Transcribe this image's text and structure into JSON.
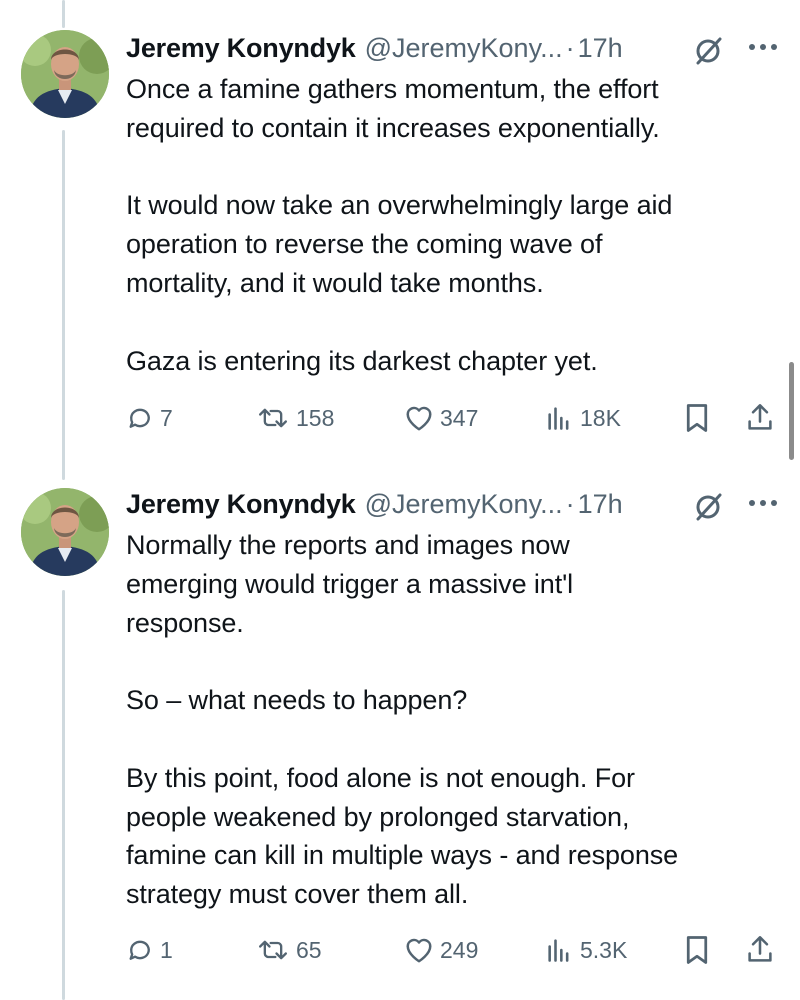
{
  "tweets": [
    {
      "author_name": "Jeremy Konyndyk",
      "handle": "@JeremyKony...",
      "separator": "·",
      "time": "17h",
      "text": "Once a famine gathers momentum, the effort\nrequired to contain it increases exponentially.\n\nIt would now take an overwhelmingly large aid\noperation to reverse the coming wave of\nmortality, and it would take months.\n\nGaza is entering its darkest chapter yet.",
      "replies": "7",
      "reposts": "158",
      "likes": "347",
      "views": "18K"
    },
    {
      "author_name": "Jeremy Konyndyk",
      "handle": "@JeremyKony...",
      "separator": "·",
      "time": "17h",
      "text": "Normally the reports and images now\nemerging would trigger a massive int'l\nresponse.\n\nSo – what needs to happen?\n\nBy this point, food alone is not enough. For\npeople weakened by prolonged starvation,\nfamine can kill in multiple ways - and response\nstrategy must cover them all.",
      "replies": "1",
      "reposts": "65",
      "likes": "249",
      "views": "5.3K"
    }
  ],
  "icons": {
    "reply": "reply-icon",
    "repost": "repost-icon",
    "like": "heart-icon",
    "views": "views-icon",
    "bookmark": "bookmark-icon",
    "share": "share-icon",
    "grok": "grok-icon",
    "more": "more-icon"
  },
  "colors": {
    "text": "#0f1419",
    "secondary": "#536471",
    "thread_line": "#cfd9de"
  }
}
